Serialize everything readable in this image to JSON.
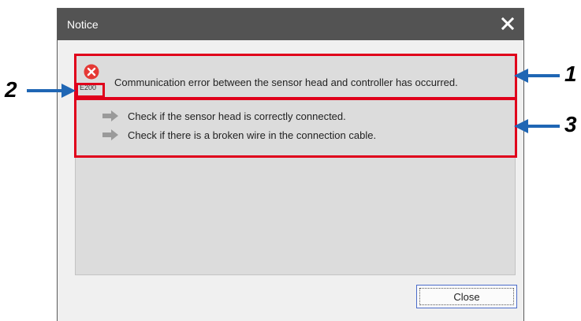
{
  "dialog": {
    "title": "Notice",
    "close_icon": "close-x-icon",
    "error": {
      "icon": "error-circle-x-icon",
      "icon_color": "#e53935",
      "code": "E200",
      "message": "Communication error between the sensor head and controller has occurred."
    },
    "checks": [
      {
        "icon": "arrow-right-icon",
        "text": "Check if the sensor head is correctly connected."
      },
      {
        "icon": "arrow-right-icon",
        "text": "Check if there is a broken wire in the connection cable."
      }
    ],
    "close_button_label": "Close"
  },
  "callouts": {
    "labels": [
      "1",
      "2",
      "3"
    ],
    "highlight_color": "#e0001b",
    "arrow_color": "#1f66b4"
  }
}
